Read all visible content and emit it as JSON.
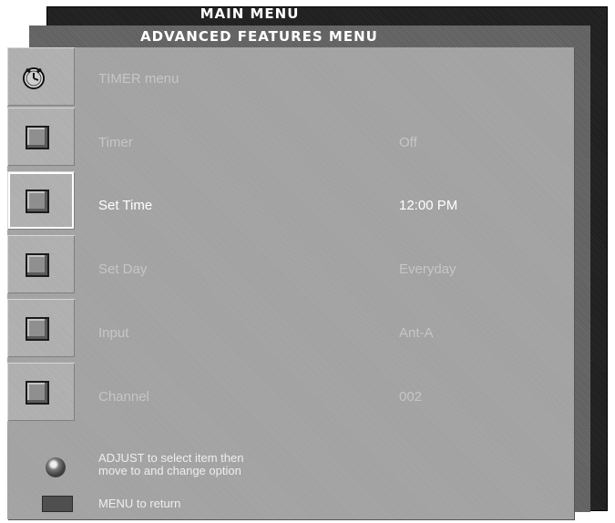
{
  "windows": {
    "back_title": "MAIN MENU",
    "mid_title": "ADVANCED FEATURES MENU",
    "front_title": "TIMER menu"
  },
  "rows": [
    {
      "label": "Timer",
      "value": "Off"
    },
    {
      "label": "Set Time",
      "value": "12:00 PM"
    },
    {
      "label": "Set Day",
      "value": "Everyday"
    },
    {
      "label": "Input",
      "value": "Ant-A"
    },
    {
      "label": "Channel",
      "value": "002"
    }
  ],
  "help": {
    "adjust_line1": "ADJUST to select item then",
    "adjust_line2": "move to and change option",
    "menu_line": "MENU to return"
  },
  "icons": {
    "header": "alarm-clock-icon",
    "row": "square-checkbox-icon",
    "adjust": "knob-icon",
    "menu": "menu-button-icon"
  },
  "colors": {
    "front_bg": "#a9a9a9",
    "selected_text": "#ffffff",
    "dim_text": "#c6c6c6"
  }
}
